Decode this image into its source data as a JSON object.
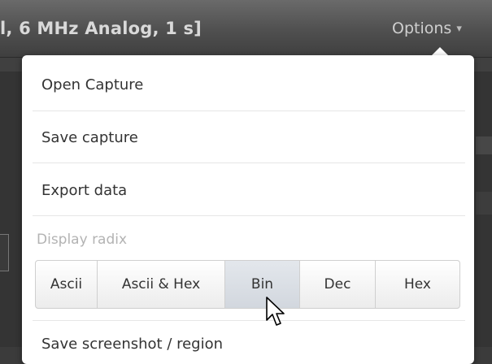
{
  "header": {
    "title": "l, 6 MHz Analog, 1 s]",
    "options_label": "Options",
    "options_chevron": "▾"
  },
  "menu": {
    "items": [
      {
        "label": "Open Capture"
      },
      {
        "label": "Save capture"
      },
      {
        "label": "Export data"
      }
    ],
    "display_radix": {
      "label": "Display radix",
      "options": [
        "Ascii",
        "Ascii & Hex",
        "Bin",
        "Dec",
        "Hex"
      ],
      "selected": "Bin"
    },
    "partial_item": "Save screenshot / region"
  },
  "cursor": {
    "icon": "mouse-pointer-icon"
  },
  "colors": {
    "header_text": "#d9d9d9",
    "menu_text": "#333333",
    "section_label": "#b3b3b3",
    "active_segment": "#d9dee5"
  }
}
